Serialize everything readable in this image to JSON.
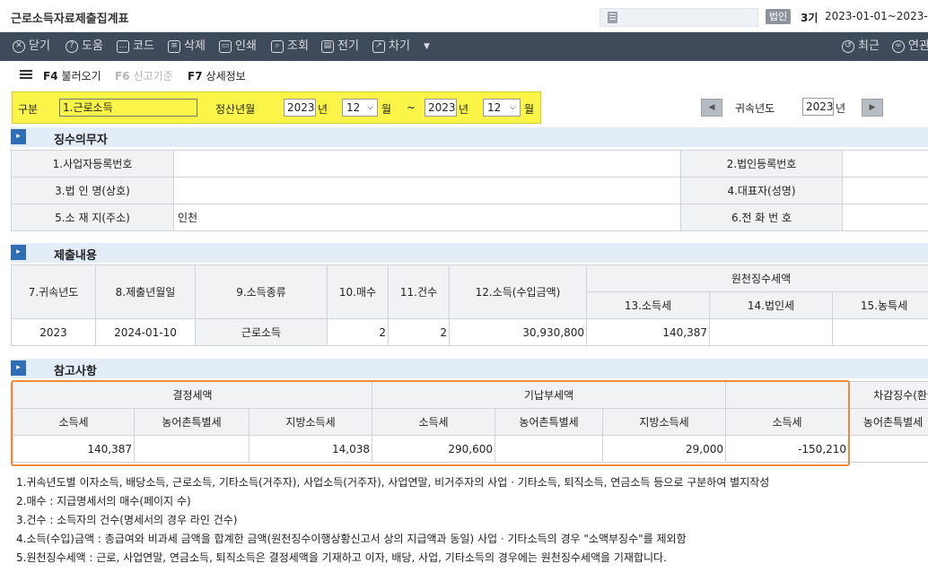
{
  "window": {
    "title": "근로소득자료제출집계표"
  },
  "header": {
    "corp_badge": "법인",
    "period": "3기",
    "date_range": "2023-01-01~2023-12"
  },
  "toolbar": {
    "close": "닫기",
    "help": "도움",
    "code": "코드",
    "delete": "삭제",
    "print": "인쇄",
    "lookup": "조회",
    "send": "전기",
    "next": "차기",
    "recent": "최근",
    "connect": "연관"
  },
  "funcbar": {
    "f4_key": "F4",
    "f4_label": "불러오기",
    "f6_key": "F6",
    "f6_label": "신고기준",
    "f7_key": "F7",
    "f7_label": "상세정보"
  },
  "filter": {
    "category_label": "구분",
    "category_value": "1.근로소득",
    "settle_label": "정산년월",
    "from_year": "2023",
    "year_unit": "년",
    "from_month": "12",
    "month_unit": "월",
    "tilde": "~",
    "to_year": "2023",
    "to_month": "12",
    "attr_year_label": "귀속년도",
    "attr_year": "2023"
  },
  "sections": {
    "withholder": "징수의무자",
    "submission": "제출내용",
    "reference": "참고사항"
  },
  "withholder": {
    "reg_no_label": "1.사업자등록번호",
    "corp_reg_label": "2.법인등록번호",
    "corp_name_label": "3.법 인 명(상호)",
    "ceo_label": "4.대표자(성명)",
    "address_label": "5.소 재 지(주소)",
    "address_value": "인천",
    "phone_label": "6.전 화  번 호"
  },
  "submission": {
    "headers": {
      "attr_year": "7.귀속년도",
      "submit_date": "8.제출년월일",
      "income_type": "9.소득종류",
      "count_sheets": "10.매수",
      "count_items": "11.건수",
      "income_amount": "12.소득(수입금액)",
      "withholding": "원천징수세액",
      "income_tax": "13.소득세",
      "corp_tax": "14.법인세",
      "rural_tax": "15.농특세"
    },
    "row": {
      "attr_year": "2023",
      "submit_date": "2024-01-10",
      "income_type": "근로소득",
      "sheets": "2",
      "items": "2",
      "amount": "30,930,800",
      "income_tax": "140,387",
      "corp_tax": "",
      "rural_tax": ""
    }
  },
  "reference": {
    "headers": {
      "decided": "결정세액",
      "prepaid": "기납부세액",
      "diff": "차감징수(환급",
      "income_tax": "소득세",
      "rural_tax": "농어촌특별세",
      "local_tax": "지방소득세"
    },
    "row": {
      "d_income": "140,387",
      "d_rural": "",
      "d_local": "14,038",
      "p_income": "290,600",
      "p_rural": "",
      "p_local": "29,000",
      "x_income": "-150,210",
      "x_rural": ""
    }
  },
  "notes": [
    "1.귀속년도별 이자소득, 배당소득, 근로소득, 기타소득(거주자), 사업소득(거주자), 사업연말, 비거주자의 사업 · 기타소득, 퇴직소득, 연금소득 등으로 구분하여 별지작성",
    "2.매수 : 지급명세서의 매수(페이지 수)",
    "3.건수 : 소득자의 건수(명세서의 경우 라인 건수)",
    "4.소득(수입)금액 : 총급여와 비과세 금액을 합계한 금액(원천징수이행상황신고서 상의 지급액과 동일) 사업 · 기타소득의 경우 \"소액부징수\"를 제외함",
    "5.원천징수세액 : 근로, 사업연말, 연금소득, 퇴직소득은 결정세액을 기재하고 이자, 배당, 사업, 기타소득의 경우에는 원천징수세액을 기재합니다."
  ]
}
